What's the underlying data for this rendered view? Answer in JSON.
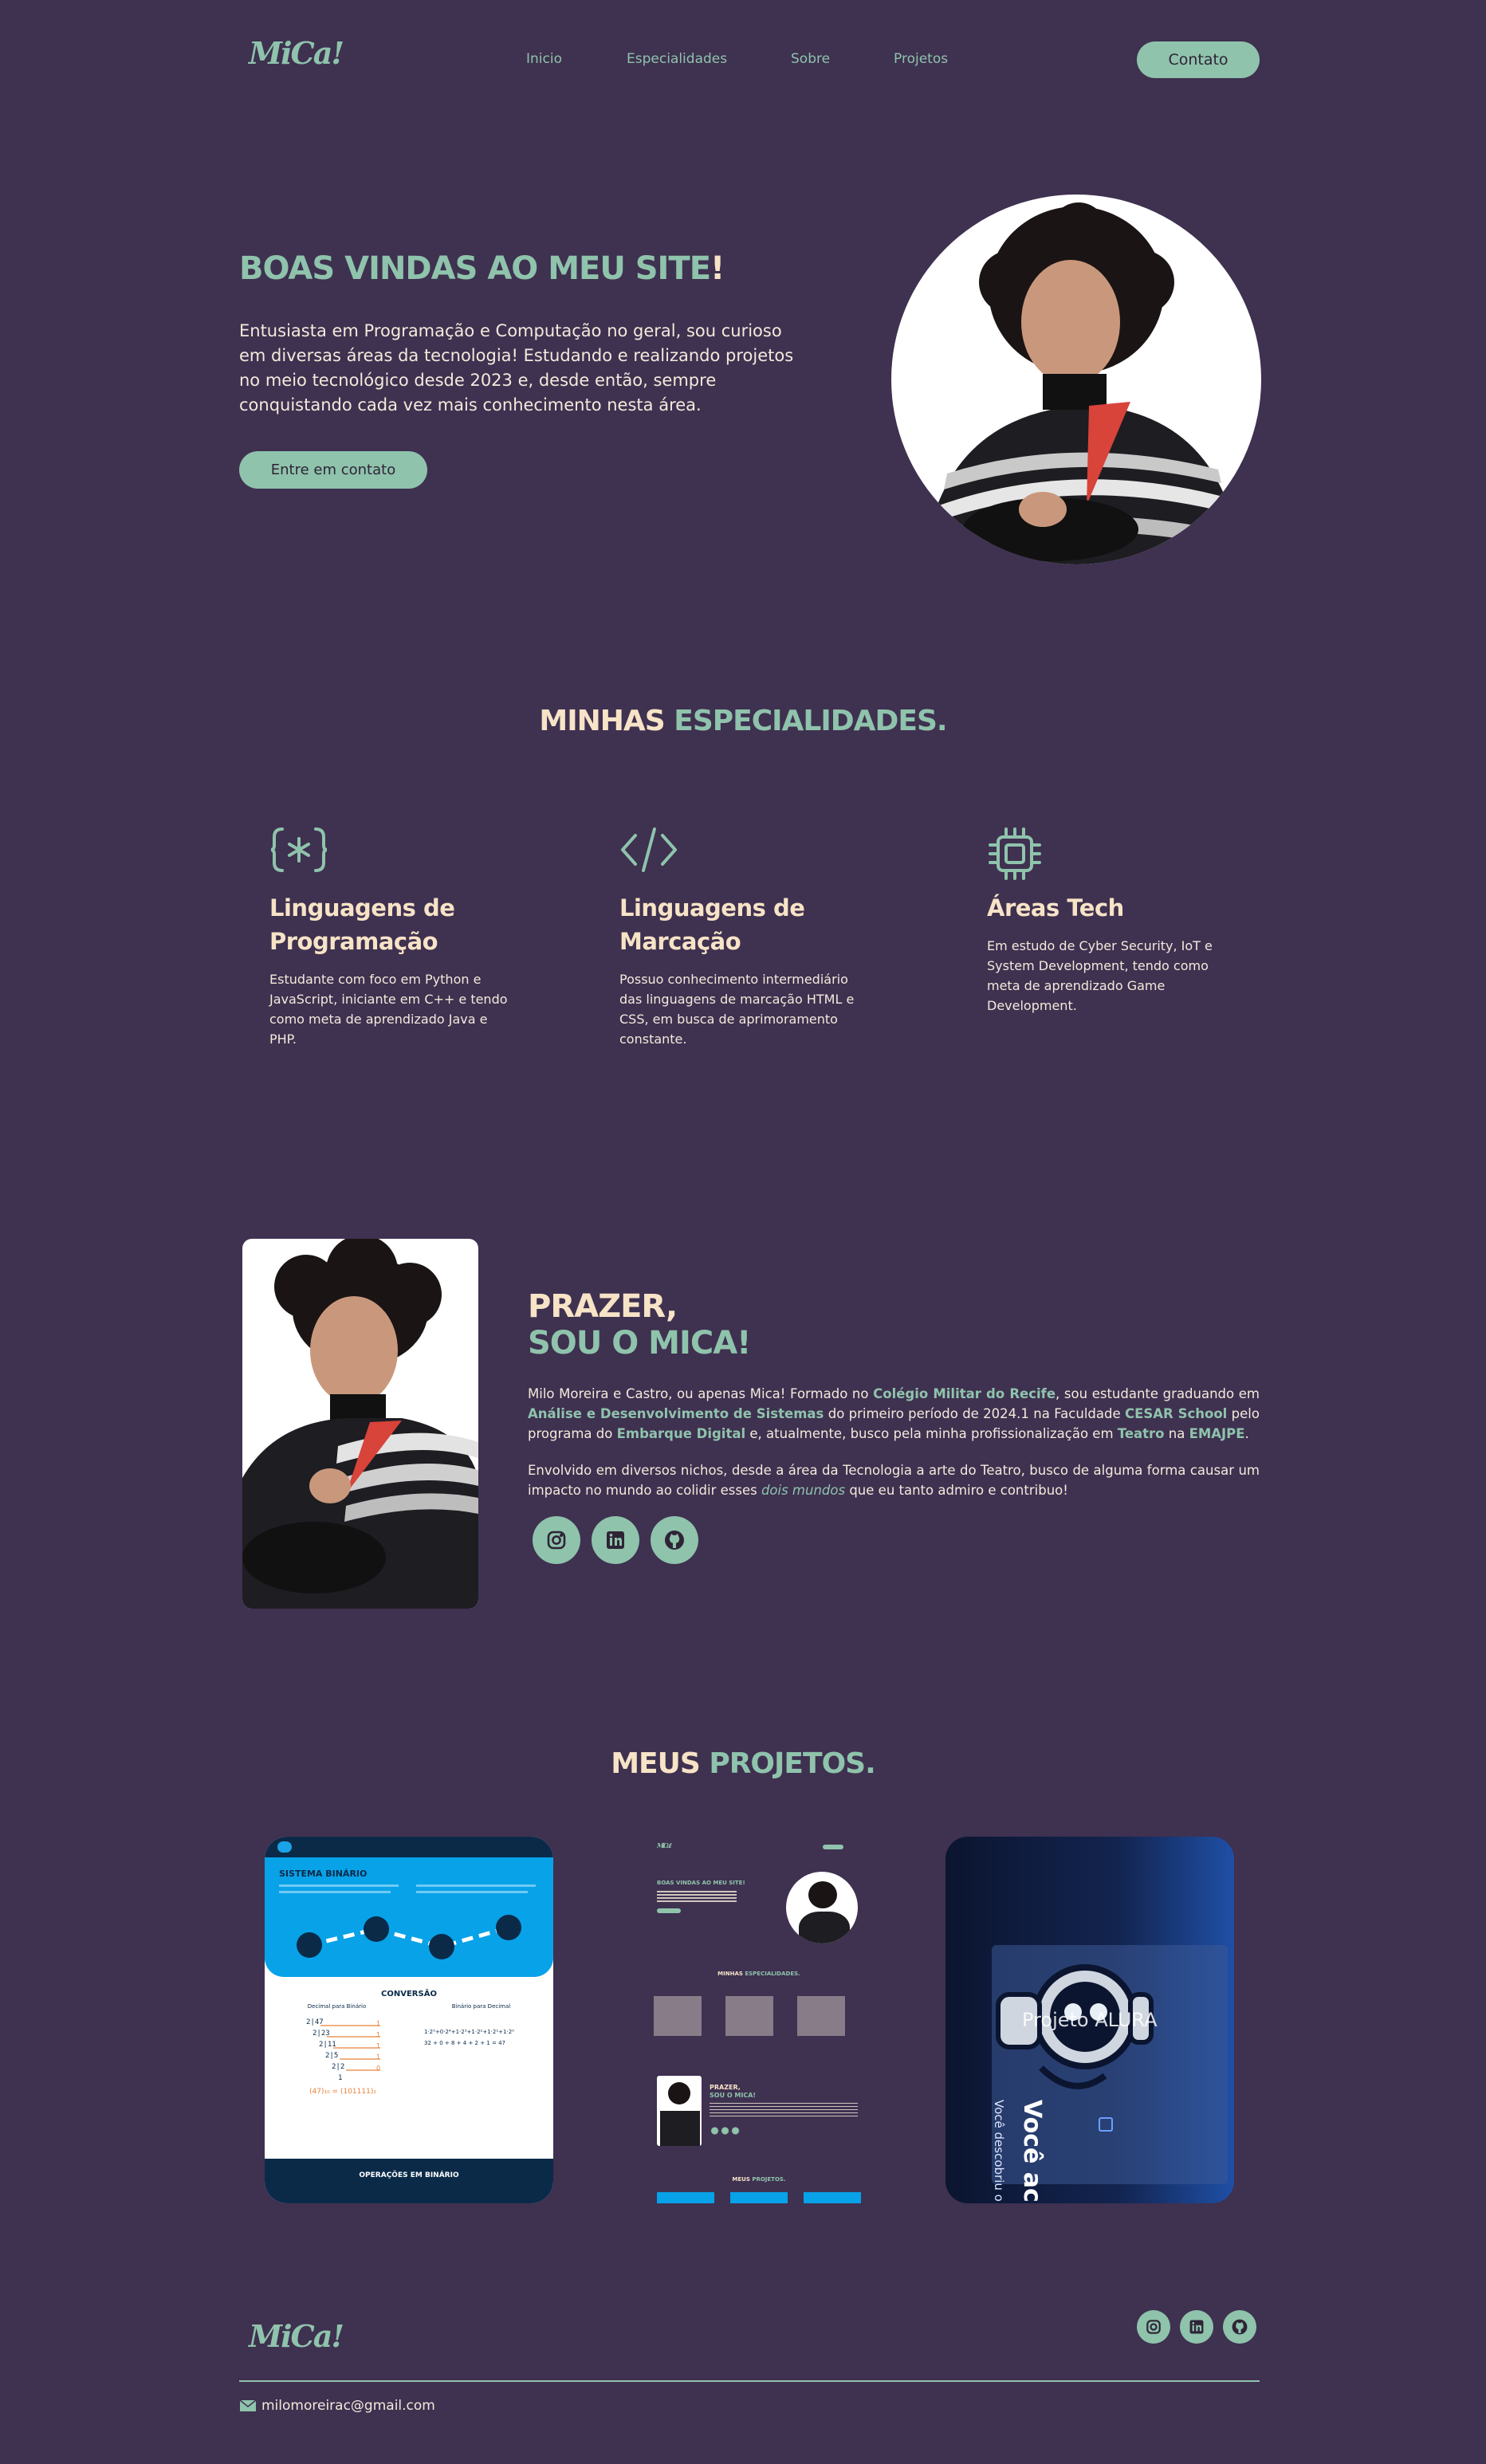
{
  "nav": {
    "logo": "MiCa!",
    "links": [
      "Inicio",
      "Especialidades",
      "Sobre",
      "Projetos"
    ],
    "contact_label": "Contato"
  },
  "hero": {
    "title_main": "BOAS VINDAS AO MEU SITE",
    "title_bang": "!",
    "text": "Entusiasta em Programação e Computação no geral, sou curioso em diversas áreas da tecnologia! Estudando e realizando projetos no meio tecnológico desde 2023 e, desde então, sempre conquistando cada vez mais conhecimento nesta área.",
    "cta_label": "Entre em contato"
  },
  "specialties": {
    "title_a": "MINHAS",
    "title_b": "ESPECIALIDADES.",
    "items": [
      {
        "icon": "code-braces-asterisk-icon",
        "title": "Linguagens de Programação",
        "text": "Estudante com foco em Python e JavaScript, iniciante em C++ e tendo como meta de aprendizado Java e PHP."
      },
      {
        "icon": "code-tag-icon",
        "title": "Linguagens de Marcação",
        "text": "Possuo conhecimento intermediário das linguagens de marcação HTML e CSS, em busca de aprimoramento constante."
      },
      {
        "icon": "cpu-chip-icon",
        "title": "Áreas Tech",
        "text": "Em estudo de Cyber Security, IoT e System Development, tendo como meta de aprendizado Game Development."
      }
    ]
  },
  "about": {
    "title_line1": "PRAZER,",
    "title_line2": "SOU O MICA!",
    "p1": {
      "t1": "Milo Moreira e Castro, ou apenas Mica! Formado no ",
      "h1": "Colégio Militar do Recife",
      "t2": ", sou estudante graduando em ",
      "h2": "Análise e Desenvolvimento de Sistemas",
      "t3": " do primeiro período de 2024.1 na Faculdade ",
      "h3": "CESAR School",
      "t4": " pelo programa do ",
      "h4": "Embarque Digital",
      "t5": " e, atualmente, busco pela minha profissionalização em ",
      "h5": "Teatro",
      "t6": " na ",
      "h6": "EMAJPE",
      "t7": "."
    },
    "p2": {
      "t1": "Envolvido em diversos nichos, desde a área da Tecnologia a arte do Teatro, busco de alguma forma causar um impacto no mundo ao colidir esses ",
      "h1": "dois mundos",
      "t2": " que eu tanto admiro e contribuo!"
    },
    "socials": [
      "instagram-icon",
      "linkedin-icon",
      "github-icon"
    ]
  },
  "projects": {
    "title_a": "MEUS",
    "title_b": "PROJETOS.",
    "binary": {
      "title": "SISTEMA BINÁRIO",
      "conversion": "CONVERSÃO",
      "dec_label": "Decimal para Binário",
      "bin_label": "Binário para Decimal",
      "result": "(47)₁₀ = (101111)₂",
      "ops": "OPERAÇÕES EM BINÁRIO"
    },
    "site_mini": {
      "hero": "BOAS VINDAS AO MEU SITE!",
      "spec_a": "MINHAS",
      "spec_b": "ESPECIALIDADES.",
      "about_a": "PRAZER,",
      "about_b": "SOU O MICA!",
      "proj_a": "MEUS",
      "proj_b": "PROJETOS."
    },
    "alura": {
      "label": "Projeto ALURA",
      "big": "Você ac",
      "sub": "Você descobriu o r"
    }
  },
  "footer": {
    "logo": "MiCa!",
    "email": "milomoreirac@gmail.com",
    "socials": [
      "instagram-icon",
      "linkedin-icon",
      "github-icon"
    ]
  },
  "colors": {
    "background": "#3f3150",
    "accent": "#8fc3ac",
    "cream": "#f7e3c6"
  }
}
